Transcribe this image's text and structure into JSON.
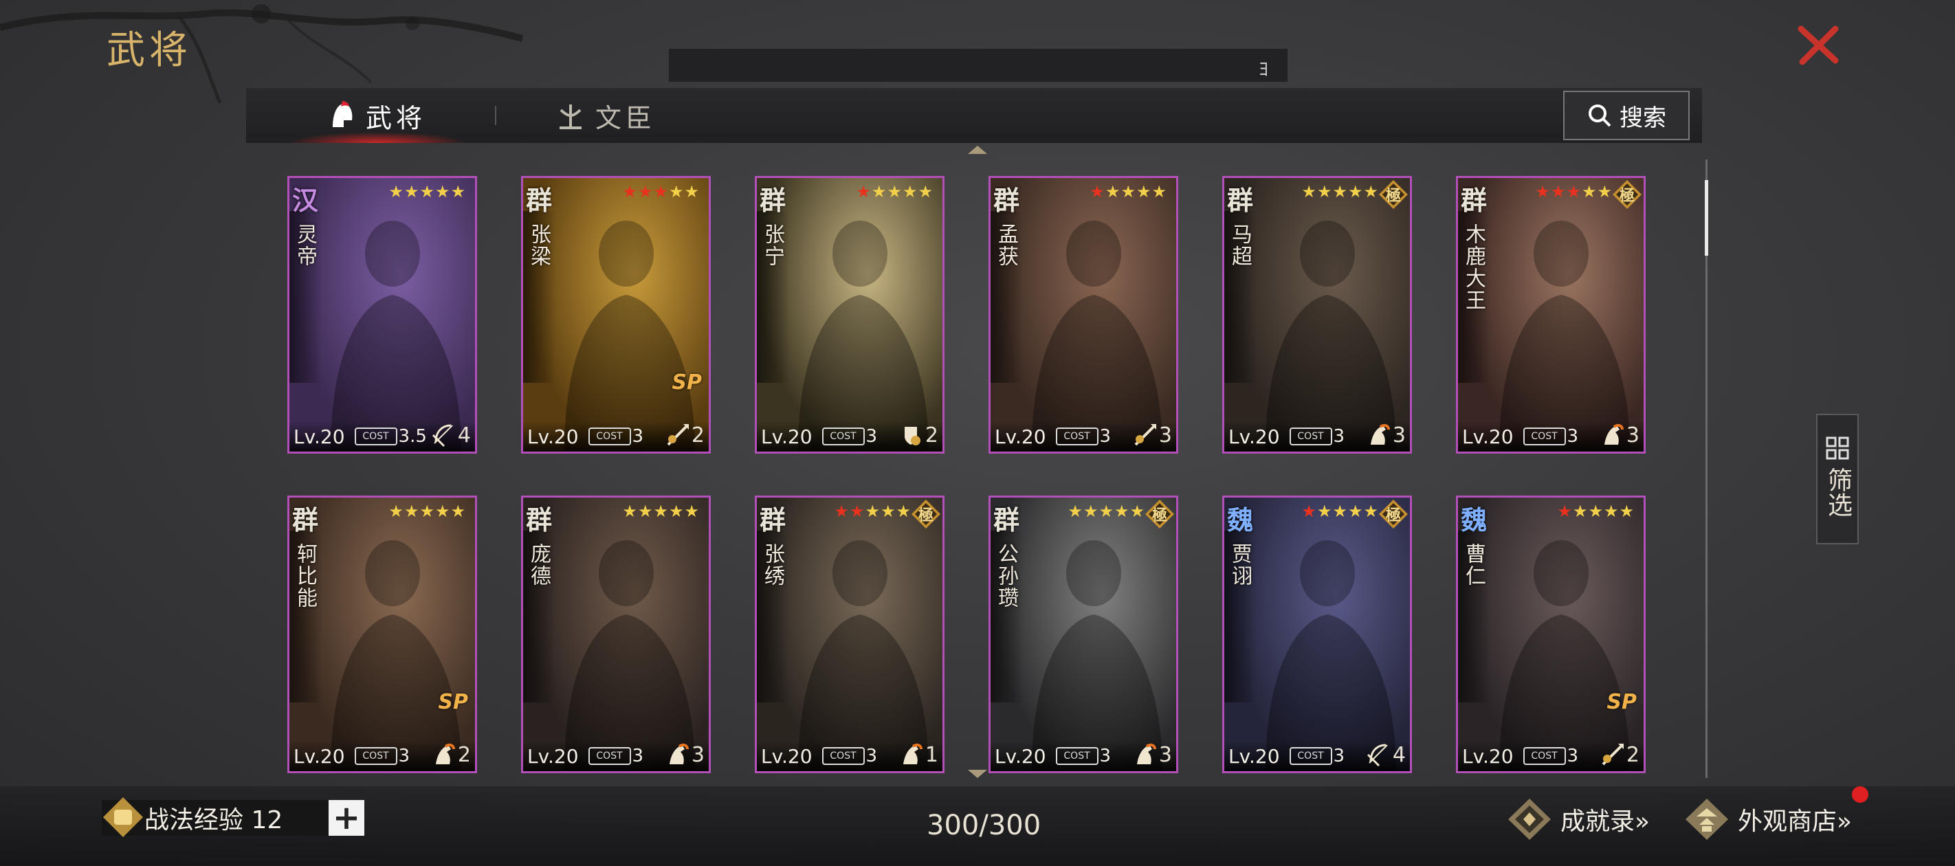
{
  "page": {
    "title": "武将",
    "topbar_mark": "ﾖ"
  },
  "tabs": [
    {
      "label": "武将",
      "active": true
    },
    {
      "label": "文臣",
      "active": false
    }
  ],
  "search": {
    "label": "搜索"
  },
  "filter": {
    "label": "筛选"
  },
  "cards": [
    {
      "faction": "汉",
      "name": "灵帝",
      "red_stars": 0,
      "stars": 5,
      "level": "Lv.20",
      "cost": "3.5",
      "troop": "bow",
      "troop_count": "4",
      "ji": false,
      "sp": false,
      "palette": [
        "#3c2a52",
        "#7b5ea3"
      ]
    },
    {
      "faction": "群",
      "name": "张梁",
      "red_stars": 3,
      "stars": 5,
      "level": "Lv.20",
      "cost": "3",
      "troop": "spear",
      "troop_count": "2",
      "ji": false,
      "sp": true,
      "palette": [
        "#5a3d10",
        "#c79a3a"
      ]
    },
    {
      "faction": "群",
      "name": "张宁",
      "red_stars": 1,
      "stars": 5,
      "level": "Lv.20",
      "cost": "3",
      "troop": "shield",
      "troop_count": "2",
      "ji": false,
      "sp": false,
      "palette": [
        "#3b3420",
        "#c7b582"
      ]
    },
    {
      "faction": "群",
      "name": "孟获",
      "red_stars": 1,
      "stars": 5,
      "level": "Lv.20",
      "cost": "3",
      "troop": "spear",
      "troop_count": "3",
      "ji": false,
      "sp": false,
      "palette": [
        "#3a2a22",
        "#8a6652"
      ]
    },
    {
      "faction": "群",
      "name": "马超",
      "red_stars": 0,
      "stars": 5,
      "level": "Lv.20",
      "cost": "3",
      "troop": "horse",
      "troop_count": "3",
      "ji": true,
      "sp": false,
      "palette": [
        "#2c2520",
        "#6a5a4c"
      ]
    },
    {
      "faction": "群",
      "name": "木鹿大王",
      "red_stars": 3,
      "stars": 5,
      "level": "Lv.20",
      "cost": "3",
      "troop": "horse",
      "troop_count": "3",
      "ji": true,
      "sp": false,
      "palette": [
        "#3a2622",
        "#9a7460"
      ]
    },
    {
      "faction": "群",
      "name": "轲比能",
      "red_stars": 0,
      "stars": 5,
      "level": "Lv.20",
      "cost": "3",
      "troop": "horse",
      "troop_count": "2",
      "ji": false,
      "sp": true,
      "palette": [
        "#3a2a20",
        "#8a6a52"
      ]
    },
    {
      "faction": "群",
      "name": "庞德",
      "red_stars": 0,
      "stars": 5,
      "level": "Lv.20",
      "cost": "3",
      "troop": "horse",
      "troop_count": "3",
      "ji": false,
      "sp": false,
      "palette": [
        "#2a2220",
        "#705a4a"
      ]
    },
    {
      "faction": "群",
      "name": "张绣",
      "red_stars": 2,
      "stars": 5,
      "level": "Lv.20",
      "cost": "3",
      "troop": "horse",
      "troop_count": "1",
      "ji": true,
      "sp": false,
      "palette": [
        "#2b2520",
        "#7a6a58"
      ]
    },
    {
      "faction": "群",
      "name": "公孙瓒",
      "red_stars": 0,
      "stars": 5,
      "level": "Lv.20",
      "cost": "3",
      "troop": "horse",
      "troop_count": "3",
      "ji": true,
      "sp": false,
      "palette": [
        "#2a2a2c",
        "#808080"
      ]
    },
    {
      "faction": "魏",
      "name": "贾诩",
      "red_stars": 1,
      "stars": 5,
      "level": "Lv.20",
      "cost": "3",
      "troop": "bow",
      "troop_count": "4",
      "ji": true,
      "sp": false,
      "palette": [
        "#24243a",
        "#5a5a8a"
      ]
    },
    {
      "faction": "魏",
      "name": "曹仁",
      "red_stars": 1,
      "stars": 5,
      "level": "Lv.20",
      "cost": "3",
      "troop": "spear",
      "troop_count": "2",
      "ji": false,
      "sp": true,
      "palette": [
        "#2a2426",
        "#6a5a5a"
      ]
    }
  ],
  "labels": {
    "ji": "極",
    "sp": "SP",
    "cost_icon": "COST"
  },
  "footer": {
    "exp_label": "战法经验 12",
    "plus_label": "+",
    "count": "300/300",
    "achievements": "成就录»",
    "shop": "外观商店»"
  }
}
